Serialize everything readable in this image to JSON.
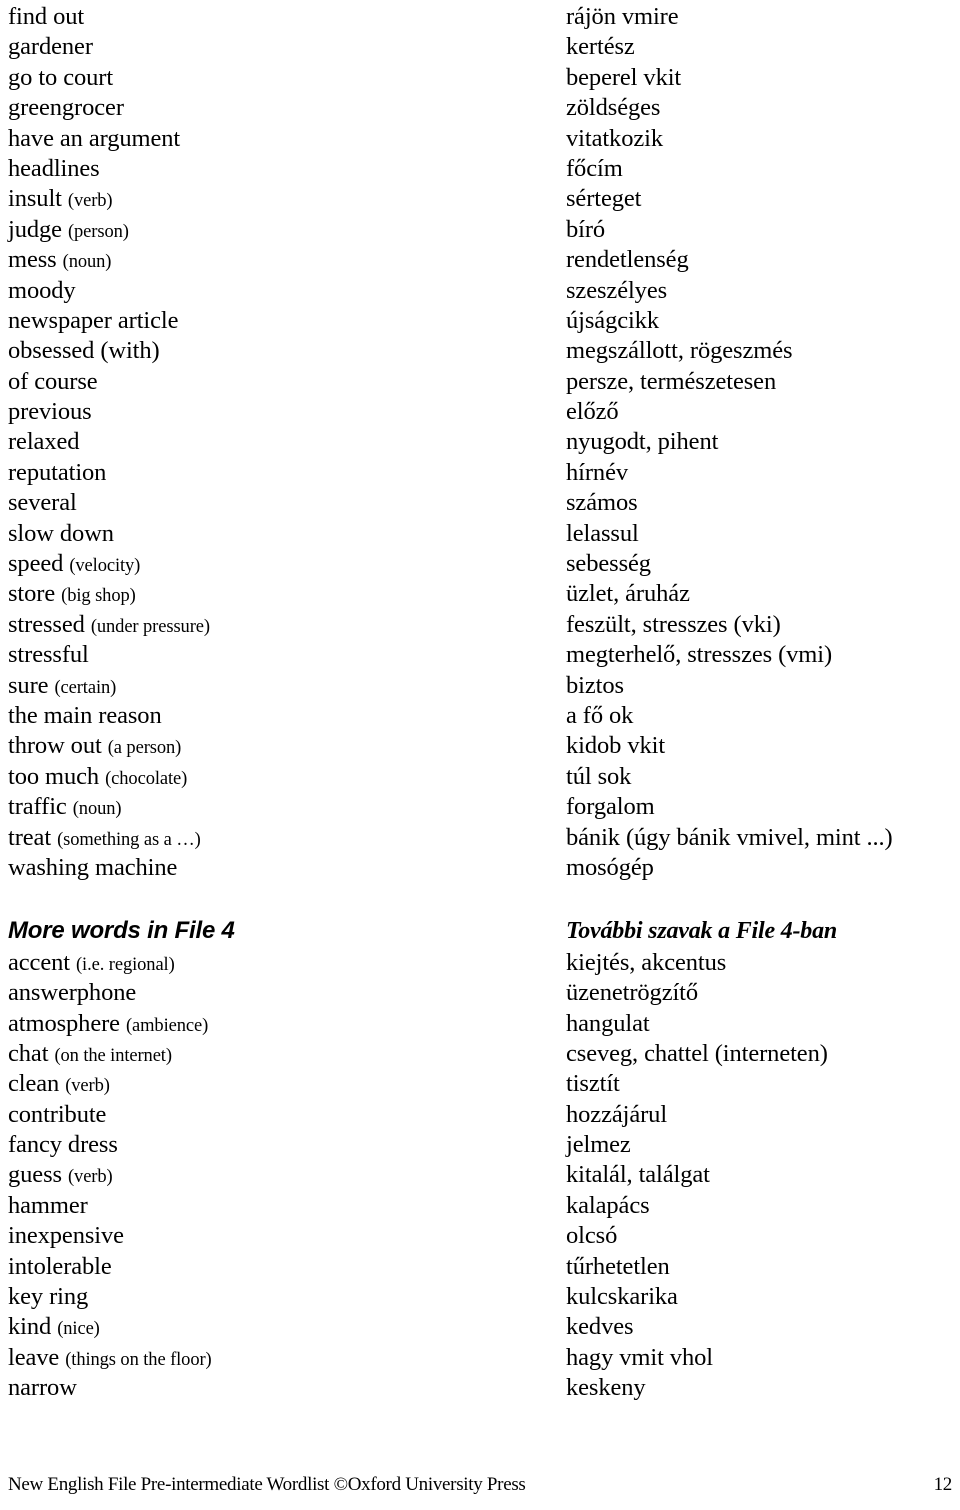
{
  "document": {
    "title": "New English File Pre-intermediate Wordlist",
    "page_number": "12",
    "footer_text": "New English File Pre-intermediate Wordlist ©Oxford University Press"
  },
  "sections": [
    {
      "heading": null,
      "entries": [
        {
          "en": "find out",
          "gloss": "",
          "hu": "rájön vmire"
        },
        {
          "en": "gardener",
          "gloss": "",
          "hu": "kertész"
        },
        {
          "en": "go to court",
          "gloss": "",
          "hu": "beperel vkit"
        },
        {
          "en": "greengrocer",
          "gloss": "",
          "hu": "zöldséges"
        },
        {
          "en": "have an argument",
          "gloss": "",
          "hu": "vitatkozik"
        },
        {
          "en": "headlines",
          "gloss": "",
          "hu": "főcím"
        },
        {
          "en": "insult",
          "gloss": "(verb)",
          "hu": "sérteget"
        },
        {
          "en": "judge",
          "gloss": "(person)",
          "hu": "bíró"
        },
        {
          "en": "mess",
          "gloss": "(noun)",
          "hu": "rendetlenség"
        },
        {
          "en": "moody",
          "gloss": "",
          "hu": "szeszélyes"
        },
        {
          "en": "newspaper article",
          "gloss": "",
          "hu": "újságcikk"
        },
        {
          "en": "obsessed (with)",
          "gloss": "",
          "hu": "megszállott, rögeszmés"
        },
        {
          "en": "of course",
          "gloss": "",
          "hu": "persze, természetesen"
        },
        {
          "en": "previous",
          "gloss": "",
          "hu": "előző"
        },
        {
          "en": "relaxed",
          "gloss": "",
          "hu": "nyugodt, pihent"
        },
        {
          "en": "reputation",
          "gloss": "",
          "hu": "hírnév"
        },
        {
          "en": "several",
          "gloss": "",
          "hu": "számos"
        },
        {
          "en": "slow down",
          "gloss": "",
          "hu": "lelassul"
        },
        {
          "en": "speed",
          "gloss": "(velocity)",
          "hu": "sebesség"
        },
        {
          "en": "store",
          "gloss": "(big shop)",
          "hu": "üzlet, áruház"
        },
        {
          "en": "stressed",
          "gloss": "(under pressure)",
          "hu": "feszült, stresszes (vki)"
        },
        {
          "en": "stressful",
          "gloss": "",
          "hu": "megterhelő, stresszes (vmi)"
        },
        {
          "en": "sure",
          "gloss": "(certain)",
          "hu": "biztos"
        },
        {
          "en": "the main reason",
          "gloss": "",
          "hu": "a fő ok"
        },
        {
          "en": "throw out",
          "gloss": "(a person)",
          "hu": "kidob vkit"
        },
        {
          "en": "too much",
          "gloss": "(chocolate)",
          "hu": "túl sok"
        },
        {
          "en": "traffic",
          "gloss": "(noun)",
          "hu": "forgalom"
        },
        {
          "en": "treat",
          "gloss": "(something as a …)",
          "hu": "bánik (úgy bánik vmivel, mint ...)"
        },
        {
          "en": "washing machine",
          "gloss": "",
          "hu": "mosógép"
        }
      ]
    },
    {
      "heading": {
        "en": "More words in File 4",
        "hu": "További szavak a File 4-ban"
      },
      "entries": [
        {
          "en": "accent",
          "gloss": "(i.e. regional)",
          "hu": "kiejtés, akcentus"
        },
        {
          "en": "answerphone",
          "gloss": "",
          "hu": "üzenetrögzítő"
        },
        {
          "en": "atmosphere",
          "gloss": "(ambience)",
          "hu": "hangulat"
        },
        {
          "en": "chat",
          "gloss": "(on the internet)",
          "hu": "cseveg, chattel (interneten)"
        },
        {
          "en": "clean",
          "gloss": "(verb)",
          "hu": "tisztít"
        },
        {
          "en": "contribute",
          "gloss": "",
          "hu": "hozzájárul"
        },
        {
          "en": "fancy dress",
          "gloss": "",
          "hu": "jelmez"
        },
        {
          "en": "guess",
          "gloss": "(verb)",
          "hu": "kitalál, találgat"
        },
        {
          "en": "hammer",
          "gloss": "",
          "hu": "kalapács"
        },
        {
          "en": "inexpensive",
          "gloss": "",
          "hu": "olcsó"
        },
        {
          "en": "intolerable",
          "gloss": "",
          "hu": "tűrhetetlen"
        },
        {
          "en": "key ring",
          "gloss": "",
          "hu": "kulcskarika"
        },
        {
          "en": "kind",
          "gloss": "(nice)",
          "hu": "kedves"
        },
        {
          "en": "leave",
          "gloss": "(things on the floor)",
          "hu": "hagy vmit vhol"
        },
        {
          "en": "narrow",
          "gloss": "",
          "hu": "keskeny"
        }
      ]
    }
  ]
}
